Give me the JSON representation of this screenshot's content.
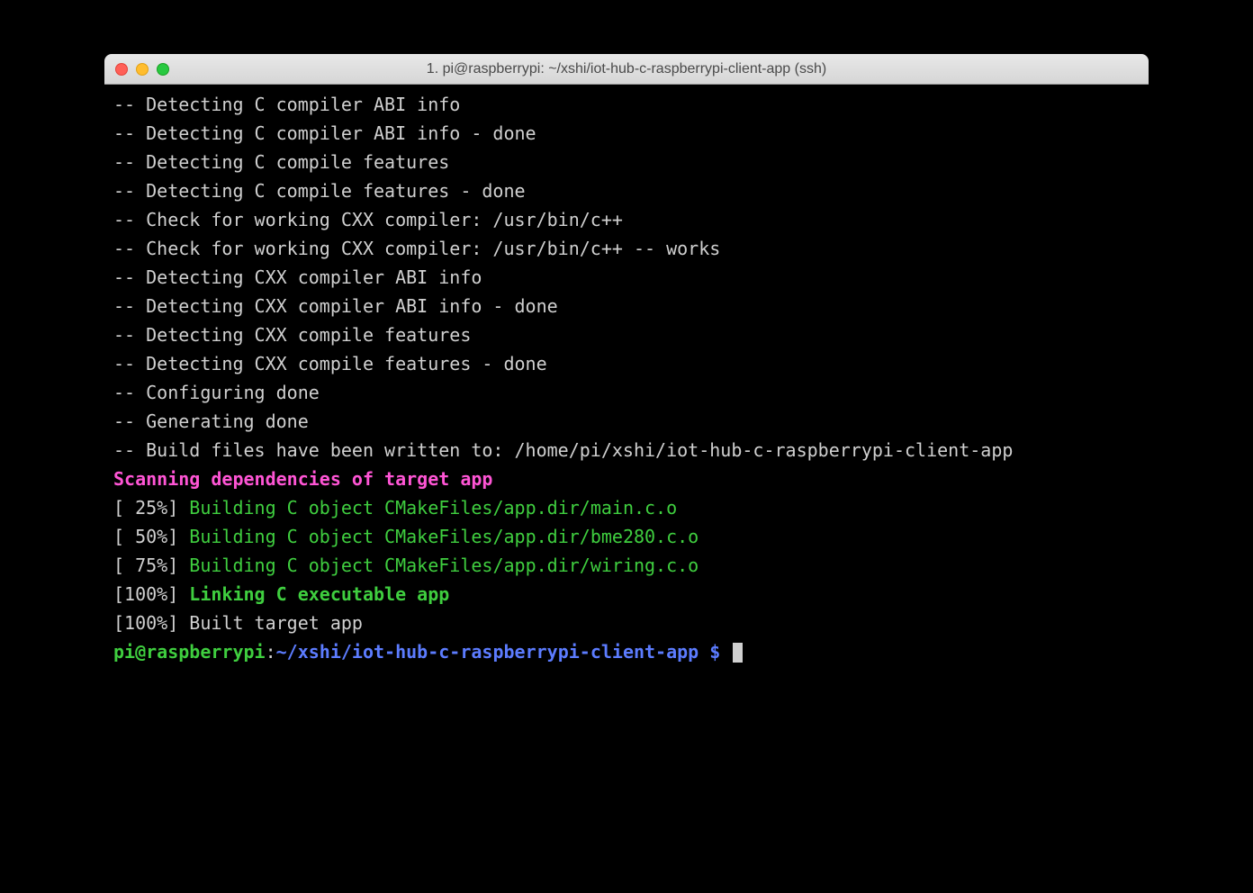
{
  "window": {
    "title": "1. pi@raspberrypi: ~/xshi/iot-hub-c-raspberrypi-client-app (ssh)"
  },
  "lines": {
    "l0": "-- Detecting C compiler ABI info",
    "l1": "-- Detecting C compiler ABI info - done",
    "l2": "-- Detecting C compile features",
    "l3": "-- Detecting C compile features - done",
    "l4": "-- Check for working CXX compiler: /usr/bin/c++",
    "l5": "-- Check for working CXX compiler: /usr/bin/c++ -- works",
    "l6": "-- Detecting CXX compiler ABI info",
    "l7": "-- Detecting CXX compiler ABI info - done",
    "l8": "-- Detecting CXX compile features",
    "l9": "-- Detecting CXX compile features - done",
    "l10": "-- Configuring done",
    "l11": "-- Generating done",
    "l12": "-- Build files have been written to: /home/pi/xshi/iot-hub-c-raspberrypi-client-app",
    "scan": "Scanning dependencies of target app",
    "b1p": "[ 25%] ",
    "b1t": "Building C object CMakeFiles/app.dir/main.c.o",
    "b2p": "[ 50%] ",
    "b2t": "Building C object CMakeFiles/app.dir/bme280.c.o",
    "b3p": "[ 75%] ",
    "b3t": "Building C object CMakeFiles/app.dir/wiring.c.o",
    "b4p": "[100%] ",
    "b4t": "Linking C executable app",
    "b5": "[100%] Built target app"
  },
  "prompt": {
    "user": "pi@raspberrypi",
    "colon": ":",
    "path": "~/xshi/iot-hub-c-raspberrypi-client-app $",
    "space": " "
  }
}
